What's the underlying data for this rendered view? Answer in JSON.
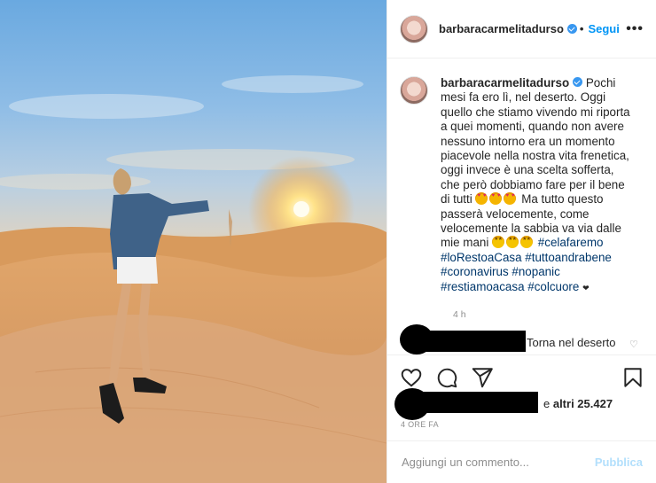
{
  "post": {
    "username": "barbaracarmelitadurso",
    "header_separator": "•",
    "follow_label": "Segui",
    "more_label": "•••",
    "photo_alt": "Donna nel deserto al tramonto che lascia scorrere la sabbia dalle mani"
  },
  "caption": {
    "username": "barbaracarmelitadurso",
    "text_part1": "Pochi mesi fa ero lì, nel deserto. Oggi quello che stiamo vivendo mi riporta a quei momenti, quando non avere nessuno intorno era un momento piacevole nella nostra vita frenetica, oggi invece è una scelta sofferta, che però dobbiamo fare per il bene di tutti",
    "text_part2": "Ma tutto questo passerà velocemente, come velocemente la sabbia va via dalle mie mani",
    "hashtags": [
      "#celafaremo",
      "#loRestoaCasa",
      "#tuttoandrabene",
      "#coronavirus",
      "#nopanic",
      "#restiamoacasa",
      "#colcuore"
    ],
    "end_symbol": "❤",
    "time": "4 h"
  },
  "comment": {
    "text": "Torna nel deserto",
    "like_icon": "heart-outline-icon"
  },
  "actions": {
    "icons": [
      "heart-icon",
      "comment-icon",
      "share-icon",
      "save-icon"
    ]
  },
  "likes": {
    "prefix": "e ",
    "count_label": "altri 25.427"
  },
  "date_label": "4 ORE FA",
  "add_comment": {
    "placeholder": "Aggiungi un commento...",
    "publish_label": "Pubblica"
  },
  "colors": {
    "accent": "#0095f6",
    "hashtag": "#00376b",
    "muted": "#8e8e8e",
    "publish_disabled": "#b2dffc"
  }
}
